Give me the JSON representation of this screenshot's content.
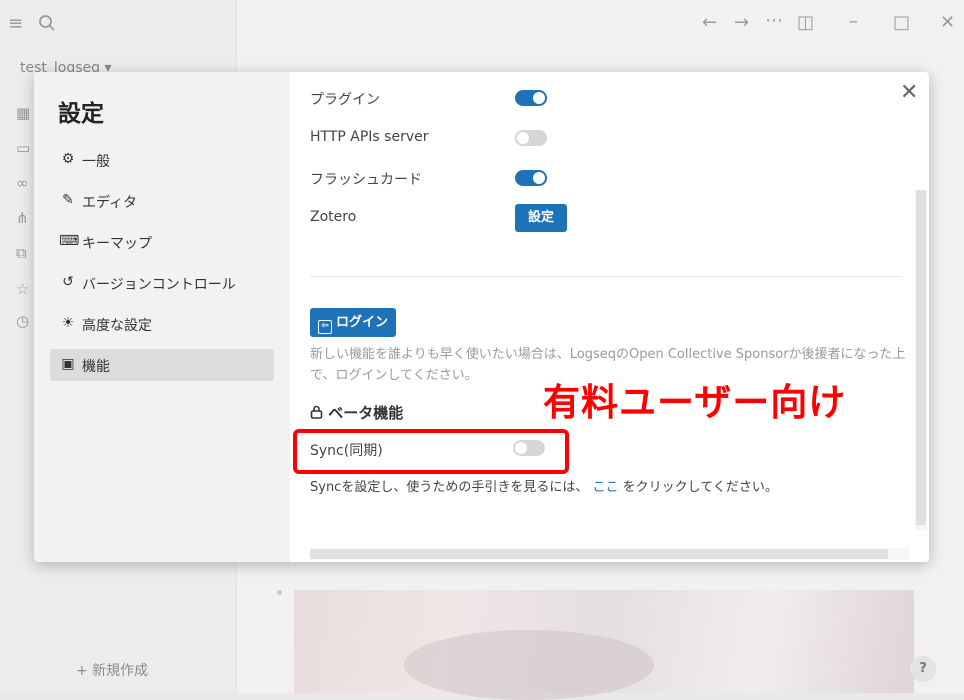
{
  "app": {
    "graph_name": "test_logseq ▾",
    "new_page_label": "+ 新規作成",
    "help_label": "?",
    "topbar_icons": [
      "menu-icon",
      "search-icon",
      "back-arrow-icon",
      "forward-arrow-icon",
      "more-icon",
      "sidebar-toggle-icon",
      "minimize-icon",
      "maximize-icon",
      "window-close-icon"
    ],
    "sidebar_icons": [
      "journals-icon",
      "flashcards-icon",
      "graph-icon",
      "graph-view-icon",
      "all-pages-icon",
      "favorites-icon",
      "recent-icon"
    ]
  },
  "settings": {
    "title": "設定",
    "close_label": "✕",
    "nav": [
      {
        "icon": "sliders-icon",
        "glyph": "⚙",
        "label": "一般",
        "active": false
      },
      {
        "icon": "editor-icon",
        "glyph": "✎",
        "label": "エディタ",
        "active": false
      },
      {
        "icon": "keyboard-icon",
        "glyph": "⌨",
        "label": "キーマップ",
        "active": false
      },
      {
        "icon": "history-icon",
        "glyph": "↺",
        "label": "バージョンコントロール",
        "active": false
      },
      {
        "icon": "lightbulb-icon",
        "glyph": "☀",
        "label": "高度な設定",
        "active": false
      },
      {
        "icon": "features-icon",
        "glyph": "▣",
        "label": "機能",
        "active": true
      }
    ],
    "features": {
      "plugins": {
        "label": "プラグイン",
        "enabled": true
      },
      "http_api": {
        "label": "HTTP APIs server",
        "enabled": false
      },
      "flashcards": {
        "label": "フラッシュカード",
        "enabled": true
      },
      "zotero": {
        "label": "Zotero",
        "button": "設定"
      },
      "login_button": "ログイン",
      "login_help": "新しい機能を誰よりも早く使いたい場合は、LogseqのOpen Collective Sponsorか後援者になった上で、ログインしてください。",
      "beta_title": "ベータ機能",
      "sync": {
        "label": "Sync(同期)",
        "enabled": false
      },
      "sync_desc_before": "Syncを設定し、使うための手引きを見るには、",
      "sync_desc_link": "ここ",
      "sync_desc_after": "をクリックしてください。"
    }
  },
  "annotation": {
    "text": "有料ユーザー向け",
    "color": "#ff0000"
  },
  "colors": {
    "accent": "#1e73b8",
    "toggle_off": "#d6d6d6"
  }
}
